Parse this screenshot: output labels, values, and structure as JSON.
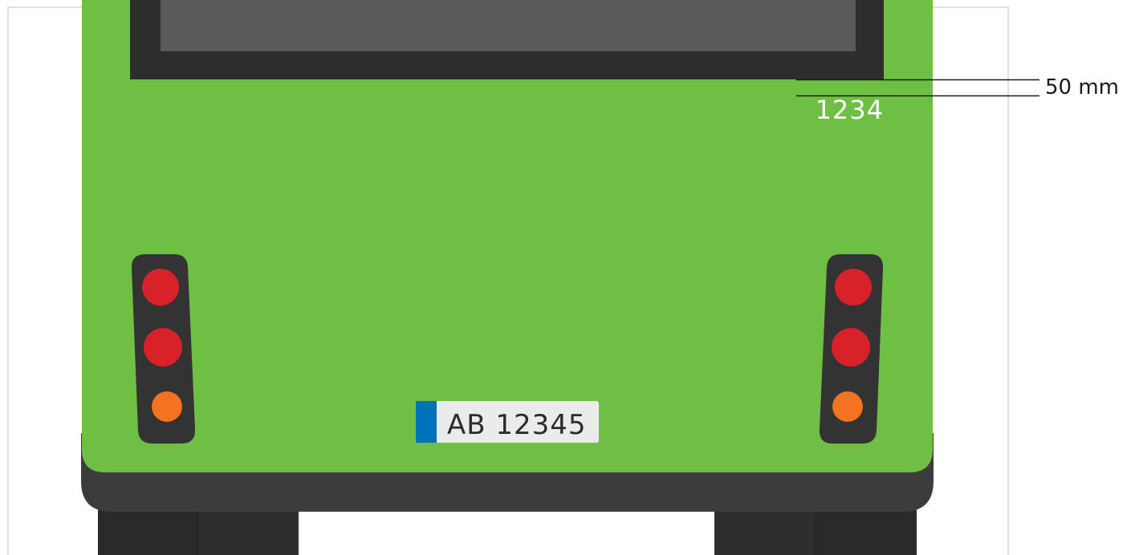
{
  "bus_number": "1234",
  "license_plate": "AB 12345",
  "dimension_label": "50 mm",
  "colors": {
    "body": "#70bf45",
    "bumper": "#3c3c3c",
    "window_frame": "#2e2d2e",
    "window_glass": "#5a5a5a",
    "tire": "#2a2a2a",
    "light_housing": "#333333",
    "brake_light": "#d82128",
    "indicator_light": "#f47220",
    "plate_band": "#0072bc",
    "plate_bg": "#ebebeb",
    "frame_border": "#bfbfbf"
  }
}
